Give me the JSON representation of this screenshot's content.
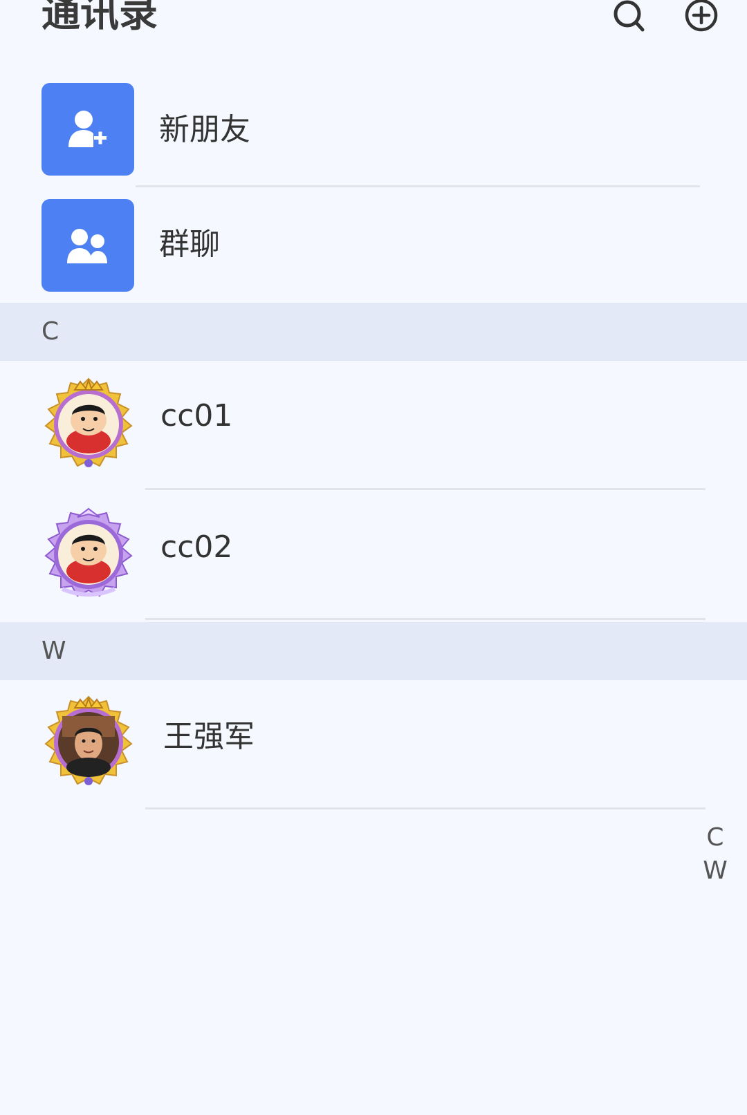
{
  "header": {
    "title": "通讯录",
    "search_icon": "search-icon",
    "add_icon": "plus-circle-icon"
  },
  "shortcuts": [
    {
      "label": "新朋友",
      "icon": "add-friend-icon"
    },
    {
      "label": "群聊",
      "icon": "group-chat-icon"
    }
  ],
  "sections": [
    {
      "letter": "C",
      "contacts": [
        {
          "name": "cc01",
          "avatar": "cartoon-avatar-gold-frame"
        },
        {
          "name": "cc02",
          "avatar": "cartoon-avatar-purple-frame"
        }
      ]
    },
    {
      "letter": "W",
      "contacts": [
        {
          "name": "王强军",
          "avatar": "photo-avatar-gold-frame"
        }
      ]
    }
  ],
  "index_bar": [
    "C",
    "W"
  ],
  "colors": {
    "background": "#f5f8fe",
    "accent": "#4d80f3",
    "section_header": "#e3e9f7",
    "divider": "#e1e4e9"
  }
}
